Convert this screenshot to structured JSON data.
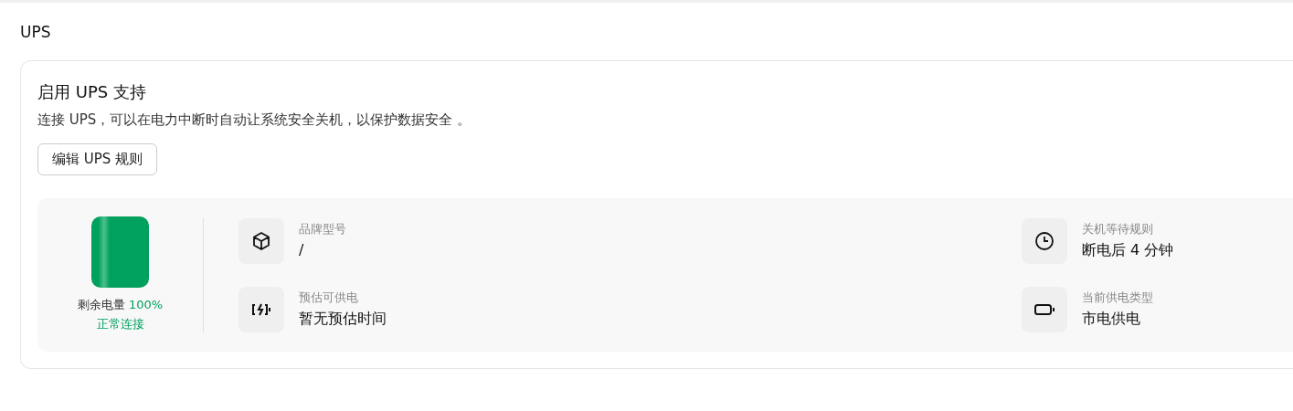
{
  "section_title": "UPS",
  "card": {
    "title": "启用 UPS 支持",
    "description": "连接 UPS，可以在电力中断时自动让系统安全关机，以保护数据安全 。",
    "button": "编辑 UPS 规则"
  },
  "battery": {
    "label": "剩余电量",
    "percent": "100%",
    "status": "正常连接"
  },
  "info": [
    {
      "kind": "box",
      "label": "品牌型号",
      "value": "/"
    },
    {
      "kind": "clock",
      "label": "关机等待规则",
      "value": "断电后 4 分钟"
    },
    {
      "kind": "charging",
      "label": "预估可供电",
      "value": "暂无预估时间"
    },
    {
      "kind": "battery",
      "label": "当前供电类型",
      "value": "市电供电"
    }
  ]
}
